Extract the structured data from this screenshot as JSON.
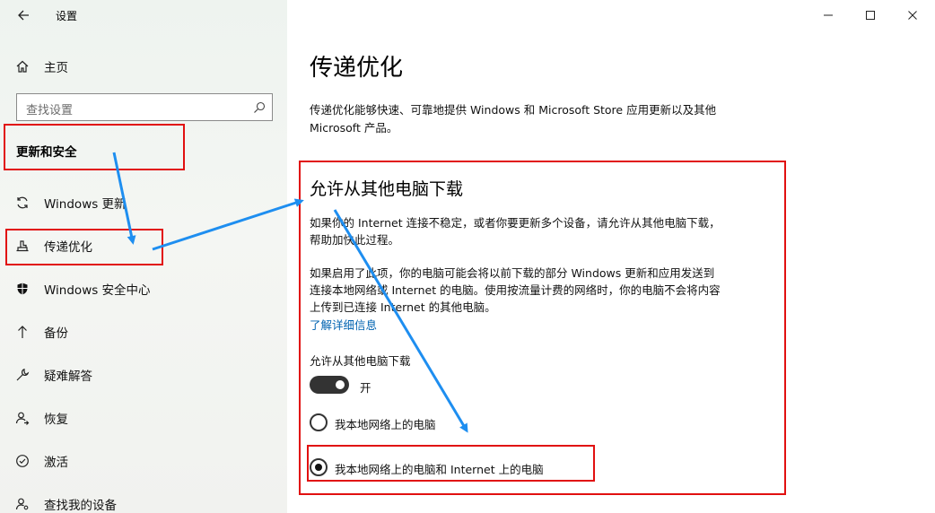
{
  "window": {
    "title": "设置"
  },
  "sidebar": {
    "home_label": "主页",
    "search_placeholder": "查找设置",
    "section_title": "更新和安全",
    "items": [
      {
        "label": "Windows 更新",
        "icon": "sync-icon"
      },
      {
        "label": "传递优化",
        "icon": "delivery-optimization-icon"
      },
      {
        "label": "Windows 安全中心",
        "icon": "shield-icon"
      },
      {
        "label": "备份",
        "icon": "backup-arrow-icon"
      },
      {
        "label": "疑难解答",
        "icon": "wrench-icon"
      },
      {
        "label": "恢复",
        "icon": "recovery-icon"
      },
      {
        "label": "激活",
        "icon": "activation-check-icon"
      },
      {
        "label": "查找我的设备",
        "icon": "find-device-icon"
      }
    ]
  },
  "main": {
    "title": "传递优化",
    "description": "传递优化能够快速、可靠地提供 Windows 和 Microsoft Store 应用更新以及其他 Microsoft 产品。",
    "section_title": "允许从其他电脑下载",
    "para1": "如果你的 Internet 连接不稳定，或者你要更新多个设备，请允许从其他电脑下载，帮助加快此过程。",
    "para2": "如果启用了此项，你的电脑可能会将以前下载的部分 Windows 更新和应用发送到连接本地网络或 Internet 的电脑。使用按流量计费的网络时，你的电脑不会将内容上传到已连接 Internet 的其他电脑。",
    "learn_more": "了解详细信息",
    "toggle_label": "允许从其他电脑下载",
    "toggle_state": "开",
    "toggle_on": true,
    "radio_options": [
      {
        "label": "我本地网络上的电脑",
        "selected": false
      },
      {
        "label": "我本地网络上的电脑和 Internet 上的电脑",
        "selected": true
      }
    ]
  },
  "annotation_color": "#e11010",
  "arrow_color": "#1e8ef0"
}
